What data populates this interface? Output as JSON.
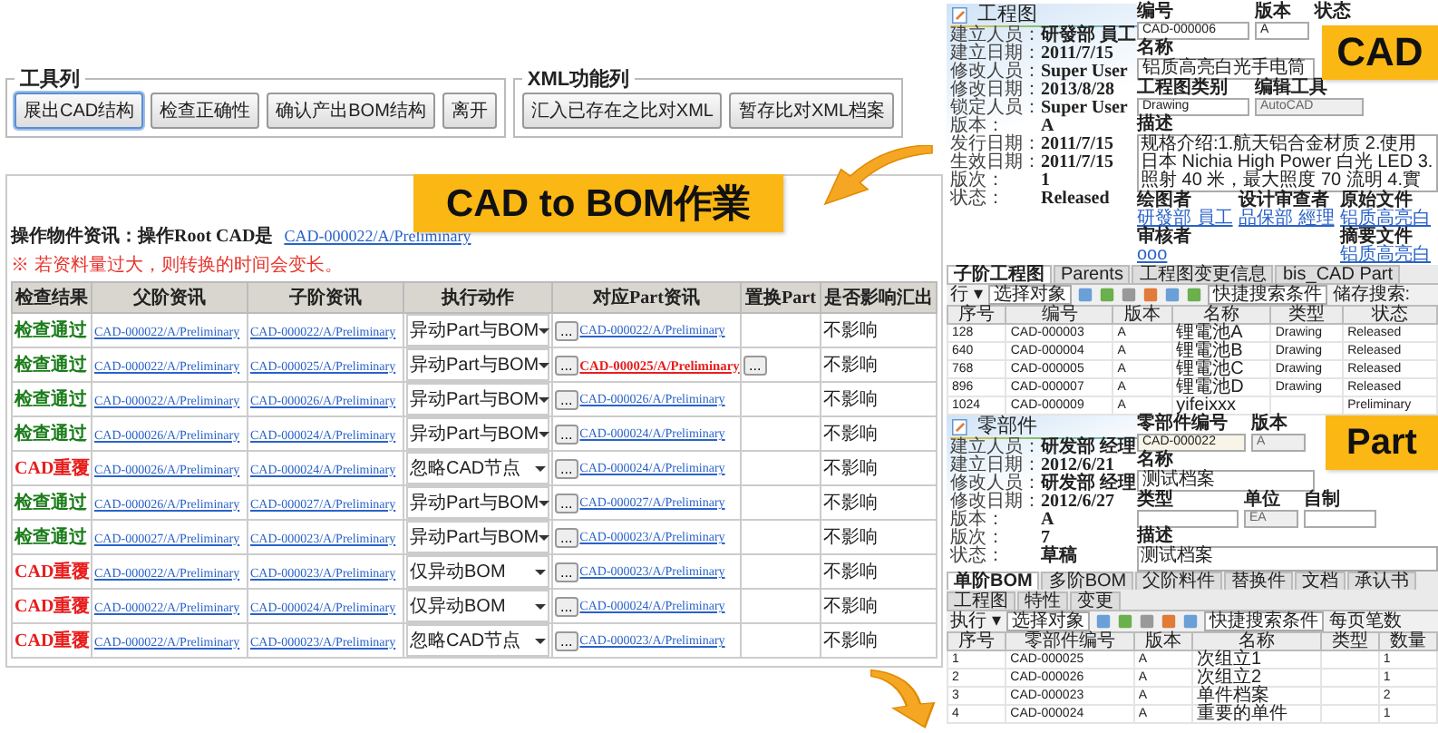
{
  "toolbar": {
    "title": "工具列",
    "buttons": [
      {
        "label": "展出CAD结构",
        "selected": true
      },
      {
        "label": "检查正确性",
        "selected": false
      },
      {
        "label": "确认产出BOM结构",
        "selected": false
      },
      {
        "label": "离开",
        "selected": false
      }
    ]
  },
  "xml_toolbar": {
    "title": "XML功能列",
    "buttons": [
      "汇入已存在之比对XML",
      "暂存比对XML档案"
    ]
  },
  "operation": {
    "label": "操作物件资讯：操作Root CAD是",
    "link": "CAD-000022/A/Preliminary",
    "warning": "※ 若资料量过大，则转换的时间会变长。"
  },
  "table": {
    "columns": [
      "检查结果",
      "父阶资讯",
      "子阶资讯",
      "执行动作",
      "对应Part资讯",
      "置换Part",
      "是否影响汇出"
    ],
    "picker_label": "...",
    "rows": [
      {
        "status": "检查通过",
        "ok": true,
        "parent": "CAD-000022/A/Preliminary",
        "child": "CAD-000022/A/Preliminary",
        "action": "异动Part与BOM",
        "part": "CAD-000022/A/Preliminary",
        "conflict": false,
        "replace": false,
        "impact": "不影响"
      },
      {
        "status": "检查通过",
        "ok": true,
        "parent": "CAD-000022/A/Preliminary",
        "child": "CAD-000025/A/Preliminary",
        "action": "异动Part与BOM",
        "part": "CAD-000025/A/Preliminary",
        "conflict": true,
        "replace": true,
        "impact": "不影响"
      },
      {
        "status": "检查通过",
        "ok": true,
        "parent": "CAD-000022/A/Preliminary",
        "child": "CAD-000026/A/Preliminary",
        "action": "异动Part与BOM",
        "part": "CAD-000026/A/Preliminary",
        "conflict": false,
        "replace": false,
        "impact": "不影响"
      },
      {
        "status": "检查通过",
        "ok": true,
        "parent": "CAD-000026/A/Preliminary",
        "child": "CAD-000024/A/Preliminary",
        "action": "异动Part与BOM",
        "part": "CAD-000024/A/Preliminary",
        "conflict": false,
        "replace": false,
        "impact": "不影响"
      },
      {
        "status": "CAD重覆",
        "ok": false,
        "parent": "CAD-000026/A/Preliminary",
        "child": "CAD-000024/A/Preliminary",
        "action": "忽略CAD节点",
        "part": "CAD-000024/A/Preliminary",
        "conflict": false,
        "replace": false,
        "impact": "不影响"
      },
      {
        "status": "检查通过",
        "ok": true,
        "parent": "CAD-000026/A/Preliminary",
        "child": "CAD-000027/A/Preliminary",
        "action": "异动Part与BOM",
        "part": "CAD-000027/A/Preliminary",
        "conflict": false,
        "replace": false,
        "impact": "不影响"
      },
      {
        "status": "检查通过",
        "ok": true,
        "parent": "CAD-000027/A/Preliminary",
        "child": "CAD-000023/A/Preliminary",
        "action": "异动Part与BOM",
        "part": "CAD-000023/A/Preliminary",
        "conflict": false,
        "replace": false,
        "impact": "不影响"
      },
      {
        "status": "CAD重覆",
        "ok": false,
        "parent": "CAD-000022/A/Preliminary",
        "child": "CAD-000023/A/Preliminary",
        "action": "仅异动BOM",
        "part": "CAD-000023/A/Preliminary",
        "conflict": false,
        "replace": false,
        "impact": "不影响"
      },
      {
        "status": "CAD重覆",
        "ok": false,
        "parent": "CAD-000022/A/Preliminary",
        "child": "CAD-000024/A/Preliminary",
        "action": "仅异动BOM",
        "part": "CAD-000024/A/Preliminary",
        "conflict": false,
        "replace": false,
        "impact": "不影响"
      },
      {
        "status": "CAD重覆",
        "ok": false,
        "parent": "CAD-000022/A/Preliminary",
        "child": "CAD-000023/A/Preliminary",
        "action": "忽略CAD节点",
        "part": "CAD-000023/A/Preliminary",
        "conflict": false,
        "replace": false,
        "impact": "不影响"
      }
    ]
  },
  "callouts": [
    {
      "kind": "bom",
      "label": "CAD to BOM作業"
    },
    {
      "kind": "cad",
      "label": "CAD"
    },
    {
      "kind": "part",
      "label": "Part"
    }
  ],
  "cad_form": {
    "title": "工程图",
    "meta": [
      {
        "label": "建立人员：",
        "value": "研發部 員工"
      },
      {
        "label": "建立日期：",
        "value": "2011/7/15"
      },
      {
        "label": "修改人员：",
        "value": "Super User"
      },
      {
        "label": "修改日期：",
        "value": "2013/8/28"
      },
      {
        "label": "锁定人员：",
        "value": "Super User"
      },
      {
        "label": "版本：",
        "value": "A"
      },
      {
        "label": "发行日期：",
        "value": "2011/7/15"
      },
      {
        "label": "生效日期：",
        "value": "2011/7/15"
      },
      {
        "label": "版次：",
        "value": "1"
      },
      {
        "label": "状态：",
        "value": "Released"
      }
    ],
    "fields": [
      {
        "label": "编号",
        "value": "CAD-000006"
      },
      {
        "label": "版本",
        "value": "A"
      },
      {
        "label": "状态"
      },
      {
        "label": "名称",
        "value": "铝质高亮白光手电筒"
      },
      {
        "label": "工程图类别",
        "value": "Drawing"
      },
      {
        "label": "编辑工具",
        "value": "AutoCAD"
      }
    ],
    "description": {
      "label": "描述",
      "value": "规格介绍:1.航天铝合金材质 2.使用日本 Nichia High Power 白光 LED 3.照射 40 米，最大照度 70 流明 4.實"
    },
    "links": [
      {
        "label": "绘图者",
        "value": "研發部 員工"
      },
      {
        "label": "设计审查者",
        "value": "品保部 經理"
      },
      {
        "label": "原始文件",
        "value": "铝质高亮白"
      },
      {
        "label": "审核者",
        "value": "ooo"
      },
      {
        "label": "摘要文件",
        "value": "铝质高亮白"
      }
    ]
  },
  "child_table": {
    "tabs": [
      {
        "label": "子阶工程图",
        "selected": true
      },
      {
        "label": "Parents",
        "selected": false
      },
      {
        "label": "工程图变更信息",
        "selected": false
      },
      {
        "label": "bis_CAD Part",
        "selected": false
      }
    ],
    "toolbar": {
      "run": "行 ▾",
      "select": "选择对象",
      "search": "快捷搜索条件",
      "saved": "储存搜索:"
    },
    "columns": [
      "序号",
      "编号",
      "版本",
      "名称",
      "类型",
      "状态"
    ],
    "rows": [
      [
        "128",
        "CAD-000003",
        "A",
        "锂電池A",
        "Drawing",
        "Released"
      ],
      [
        "640",
        "CAD-000004",
        "A",
        "锂電池B",
        "Drawing",
        "Released"
      ],
      [
        "768",
        "CAD-000005",
        "A",
        "锂電池C",
        "Drawing",
        "Released"
      ],
      [
        "896",
        "CAD-000007",
        "A",
        "锂電池D",
        "Drawing",
        "Released"
      ],
      [
        "1024",
        "CAD-000009",
        "A",
        "yifeixxx",
        "",
        "Preliminary"
      ]
    ]
  },
  "part_form": {
    "title": "零部件",
    "meta": [
      {
        "label": "建立人员：",
        "value": "研发部 经理"
      },
      {
        "label": "建立日期：",
        "value": "2012/6/21"
      },
      {
        "label": "修改人员：",
        "value": "研发部 经理"
      },
      {
        "label": "修改日期：",
        "value": "2012/6/27"
      },
      {
        "label": "版本：",
        "value": "A"
      },
      {
        "label": "版次：",
        "value": "7"
      },
      {
        "label": "状态：",
        "value": "草稿"
      }
    ],
    "fields": [
      {
        "label": "零部件编号",
        "value": "CAD-000022"
      },
      {
        "label": "版本",
        "value": "A"
      },
      {
        "label": "名称",
        "value": "测试档案"
      },
      {
        "label": "类型"
      },
      {
        "label": "单位",
        "value": "EA"
      },
      {
        "label": "自制"
      }
    ],
    "description": {
      "label": "描述",
      "value": "测试档案"
    },
    "tabs": [
      {
        "label": "单阶BOM",
        "selected": true
      },
      {
        "label": "多阶BOM",
        "selected": false
      },
      {
        "label": "父阶料件",
        "selected": false
      },
      {
        "label": "替换件",
        "selected": false
      },
      {
        "label": "文档",
        "selected": false
      },
      {
        "label": "承认书",
        "selected": false
      },
      {
        "label": "工程图",
        "selected": false
      },
      {
        "label": "特性",
        "selected": false
      },
      {
        "label": "变更",
        "selected": false
      }
    ],
    "toolbar": {
      "run": "执行 ▾",
      "select": "选择对象",
      "search": "快捷搜索条件",
      "pages": "每页笔数"
    },
    "columns": [
      "序号",
      "零部件编号",
      "版本",
      "名称",
      "类型",
      "数量"
    ],
    "rows": [
      [
        "1",
        "CAD-000025",
        "A",
        "次组立1",
        "",
        "1"
      ],
      [
        "2",
        "CAD-000026",
        "A",
        "次组立2",
        "",
        "1"
      ],
      [
        "3",
        "CAD-000023",
        "A",
        "单件档案",
        "",
        "2"
      ],
      [
        "4",
        "CAD-000024",
        "A",
        "重要的单件",
        "",
        "1"
      ]
    ]
  }
}
